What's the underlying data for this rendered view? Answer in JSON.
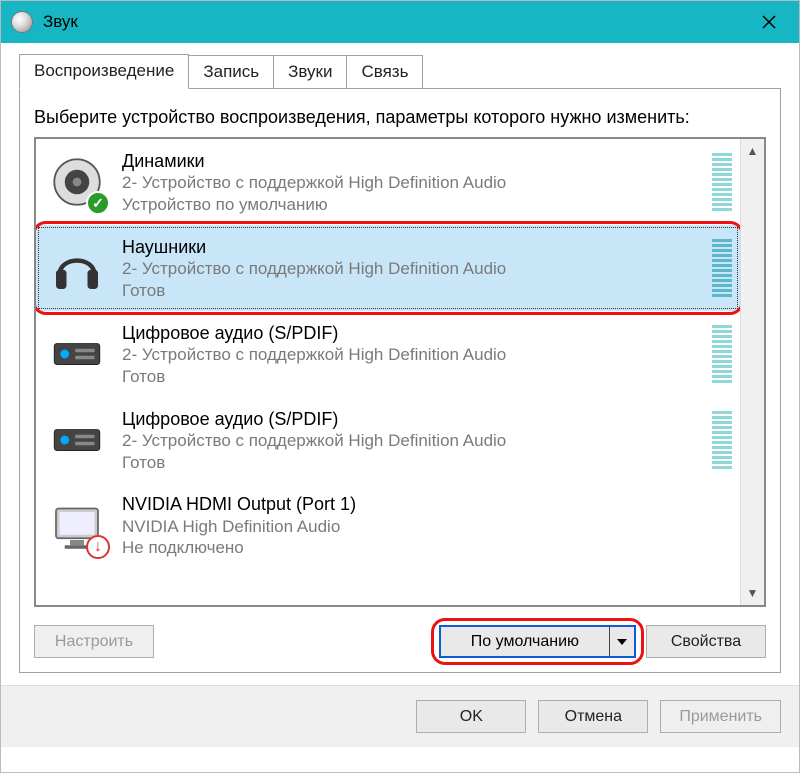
{
  "window": {
    "title": "Звук"
  },
  "tabs": [
    {
      "label": "Воспроизведение",
      "active": true
    },
    {
      "label": "Запись",
      "active": false
    },
    {
      "label": "Звуки",
      "active": false
    },
    {
      "label": "Связь",
      "active": false
    }
  ],
  "instruction": "Выберите устройство воспроизведения, параметры которого нужно изменить:",
  "devices": [
    {
      "name": "Динамики",
      "description": "2- Устройство с поддержкой High Definition Audio",
      "status": "Устройство по умолчанию",
      "icon": "speaker",
      "badge": "ok",
      "selected": false,
      "level": true
    },
    {
      "name": "Наушники",
      "description": "2- Устройство с поддержкой High Definition Audio",
      "status": "Готов",
      "icon": "headphones",
      "badge": null,
      "selected": true,
      "level": true
    },
    {
      "name": "Цифровое аудио (S/PDIF)",
      "description": "2- Устройство с поддержкой High Definition Audio",
      "status": "Готов",
      "icon": "receiver",
      "badge": null,
      "selected": false,
      "level": true
    },
    {
      "name": "Цифровое аудио (S/PDIF)",
      "description": "2- Устройство с поддержкой High Definition Audio",
      "status": "Готов",
      "icon": "receiver",
      "badge": null,
      "selected": false,
      "level": true
    },
    {
      "name": "NVIDIA HDMI Output (Port 1)",
      "description": "NVIDIA High Definition Audio",
      "status": "Не подключено",
      "icon": "monitor",
      "badge": "down",
      "selected": false,
      "level": false
    }
  ],
  "buttons": {
    "configure": "Настроить",
    "setDefault": "По умолчанию",
    "properties": "Свойства",
    "ok": "OK",
    "cancel": "Отмена",
    "apply": "Применить"
  }
}
